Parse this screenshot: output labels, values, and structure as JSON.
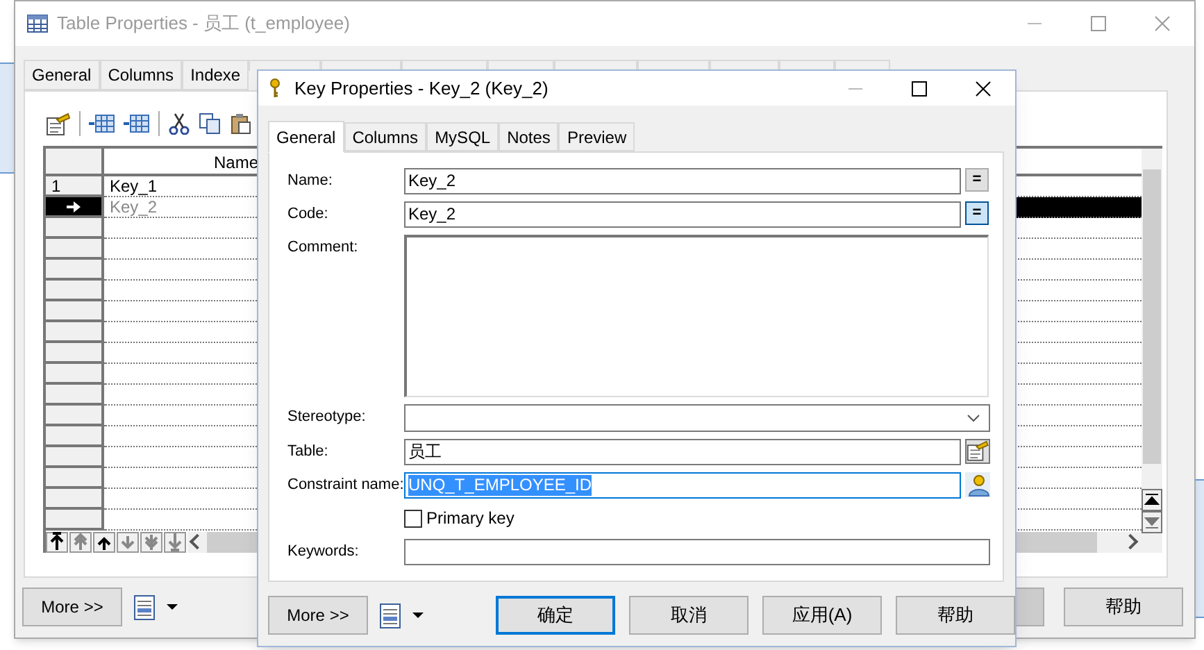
{
  "back_window": {
    "title": "Table Properties - 员工 (t_employee)",
    "active": false,
    "tabs": [
      {
        "label": "General",
        "selected": false
      },
      {
        "label": "Columns",
        "selected": false
      },
      {
        "label": "Indexe",
        "selected": false
      }
    ],
    "grid": {
      "columns": [
        "Name"
      ],
      "rows": [
        {
          "number": "1",
          "name": "Key_1",
          "current": false
        },
        {
          "name": "Key_2",
          "current": true
        }
      ]
    },
    "more_button": "More >>",
    "help_button": "帮助"
  },
  "dialog": {
    "title": "Key Properties - Key_2 (Key_2)",
    "active": true,
    "tabs": [
      {
        "label": "General",
        "selected": true
      },
      {
        "label": "Columns",
        "selected": false
      },
      {
        "label": "MySQL",
        "selected": false
      },
      {
        "label": "Notes",
        "selected": false
      },
      {
        "label": "Preview",
        "selected": false
      }
    ],
    "fields": [
      {
        "kind": "text",
        "label": "Name:",
        "value": "Key_2",
        "focused": false,
        "button": {
          "kind": "equals",
          "label": "=",
          "pressed": false
        }
      },
      {
        "kind": "text",
        "label": "Code:",
        "value": "Key_2",
        "focused": false,
        "button": {
          "kind": "equals",
          "label": "=",
          "pressed": true
        }
      },
      {
        "kind": "textarea",
        "label": "Comment:"
      },
      {
        "kind": "dropdown",
        "label": "Stereotype:"
      },
      {
        "kind": "text",
        "label": "Table:",
        "value": "员工",
        "focused": false,
        "button": {
          "kind": "properties"
        }
      },
      {
        "kind": "text",
        "label": "Constraint name:",
        "value": "UNQ_T_EMPLOYEE_ID",
        "focused": true,
        "button": {
          "kind": "user"
        }
      },
      {
        "kind": "checkbox",
        "label": "Primary key",
        "checked": false
      },
      {
        "kind": "text",
        "label": "Keywords:",
        "focused": false
      }
    ],
    "more_button": "More >>",
    "buttons": [
      {
        "label": "确定",
        "default": true
      },
      {
        "label": "取消",
        "default": false
      },
      {
        "label": "应用(A)",
        "default": false
      },
      {
        "label": "帮助",
        "default": false
      }
    ]
  }
}
